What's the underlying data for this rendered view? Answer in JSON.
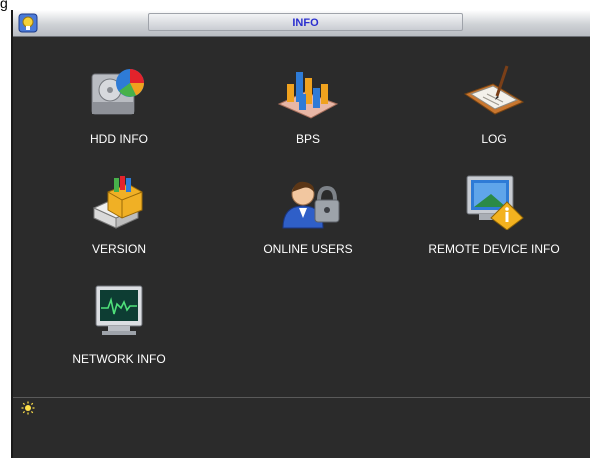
{
  "outside_label": "g",
  "window": {
    "title": "INFO"
  },
  "tiles": [
    {
      "label": "HDD INFO",
      "icon": "hdd-info-icon"
    },
    {
      "label": "BPS",
      "icon": "bps-chart-icon"
    },
    {
      "label": "LOG",
      "icon": "log-book-icon"
    },
    {
      "label": "VERSION",
      "icon": "version-box-icon"
    },
    {
      "label": "ONLINE USERS",
      "icon": "online-users-icon"
    },
    {
      "label": "REMOTE DEVICE INFO",
      "icon": "remote-device-icon"
    },
    {
      "label": "NETWORK INFO",
      "icon": "network-monitor-icon"
    }
  ],
  "colors": {
    "background": "#2b2b2b",
    "title_text": "#2b2fcf",
    "label_text": "#ffffff"
  },
  "status_bar": {
    "hint_icon": "lightbulb-icon"
  }
}
